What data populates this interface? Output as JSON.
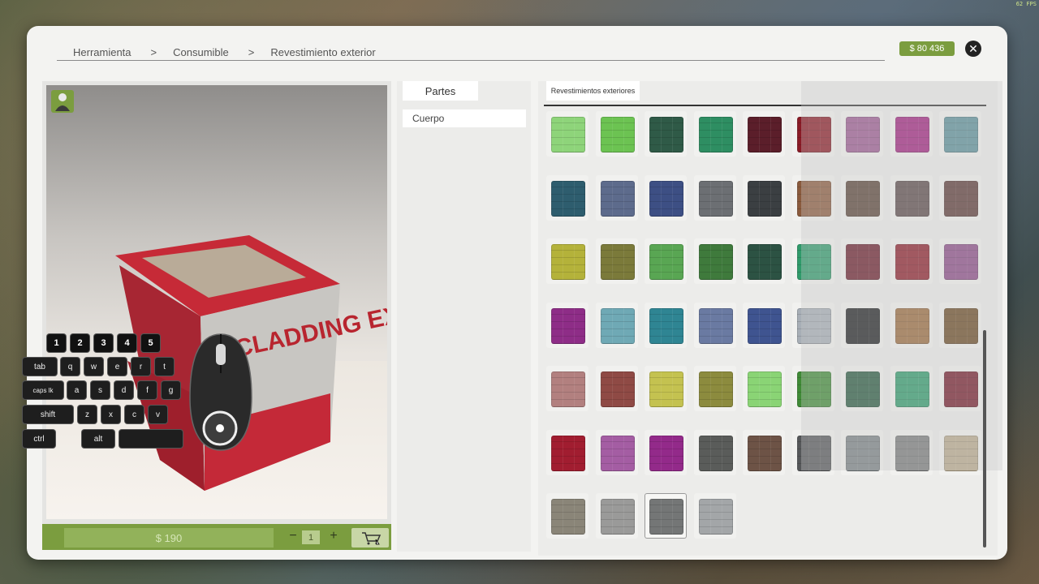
{
  "hud": {
    "fps": "62 FPS"
  },
  "breadcrumb": [
    "Herramienta",
    "Consumible",
    "Revestimiento exterior"
  ],
  "breadcrumb_separator": ">",
  "balance": "$ 80 436",
  "close_icon": "close-icon",
  "preview": {
    "product": "cladding-exterior-box",
    "product_label": "CLADDING EXTERIOR",
    "price": "$ 190",
    "quantity": "1",
    "minus": "−",
    "plus": "+",
    "cart_icon": "cart-icon"
  },
  "parts": {
    "tab": "Partes",
    "items": [
      "Cuerpo"
    ]
  },
  "tiles": {
    "tab": "Revestimientos exteriores",
    "selected_index": 56,
    "swatches": [
      "#8ed47a",
      "#6cc352",
      "#2f5a47",
      "#2e8e62",
      "#5b1e2a",
      "#8a1b26",
      "#9b5a91",
      "#a0237e",
      "#5b8f98",
      "#2e5d6e",
      "#5d6b8c",
      "#3d4f84",
      "#6c6f73",
      "#3b3f42",
      "#8a5a3c",
      "#5a4438",
      "#5b4a4a",
      "#5b3a36",
      "#b4b23a",
      "#7b7a3a",
      "#59a653",
      "#3f7a3c",
      "#2c5243",
      "#2f9a6a",
      "#6b1e2c",
      "#8c1e2a",
      "#8a4a86",
      "#8e2d87",
      "#6fa9b5",
      "#2f8593",
      "#6a7aa2",
      "#3f5490",
      "#a7aeb6",
      "#1f2123",
      "#9a6a3c",
      "#6b4a24",
      "#b2807f",
      "#8f4a45",
      "#c4c250",
      "#8c8b3e",
      "#8ad475",
      "#3f8a36",
      "#285940",
      "#2f9a6a",
      "#731b2a",
      "#a11d30",
      "#a45da3",
      "#932a8a",
      "#5a5c5a",
      "#6d5346",
      "#555759",
      "#7a8184",
      "#7a7c7c",
      "#b8a98c",
      "#8a8578",
      "#9a9a99",
      "#747676",
      "#a3a6a8"
    ]
  },
  "keyboard": {
    "row1": [
      "1",
      "2",
      "3",
      "4",
      "5"
    ],
    "row2": [
      "tab",
      "q",
      "w",
      "e",
      "r",
      "t"
    ],
    "row3": [
      "caps lk",
      "a",
      "s",
      "d",
      "f",
      "g"
    ],
    "row4": [
      "shift",
      "z",
      "x",
      "c",
      "v"
    ],
    "row5": [
      "ctrl",
      "alt",
      ""
    ]
  }
}
